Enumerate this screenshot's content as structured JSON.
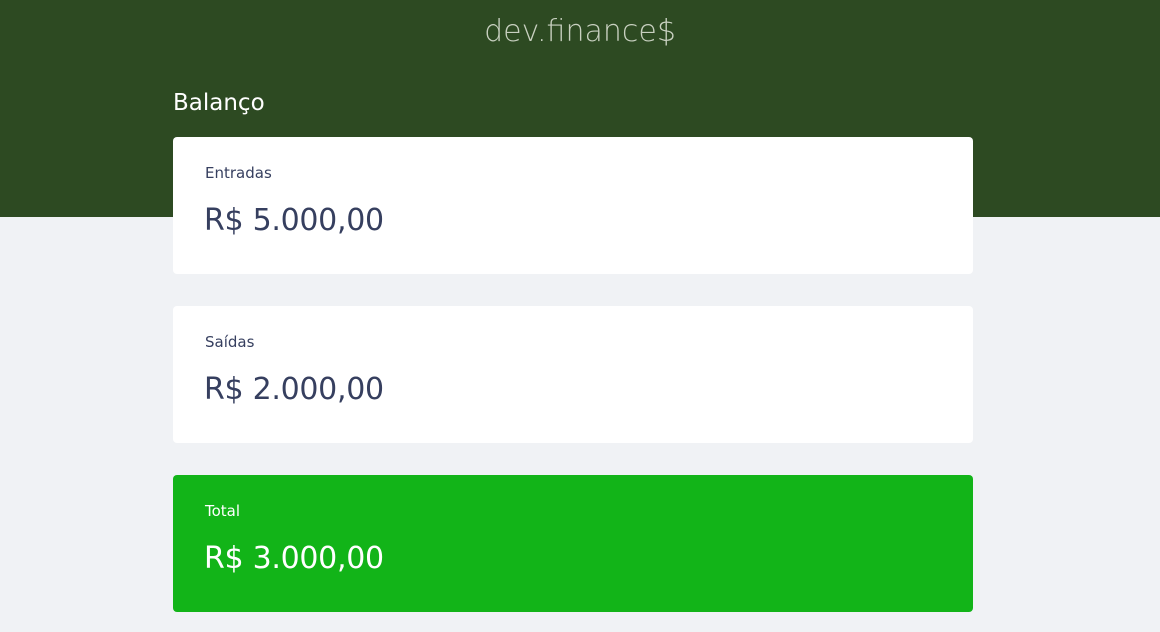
{
  "header": {
    "logo": "dev.finance$"
  },
  "balance": {
    "title": "Balanço",
    "cards": [
      {
        "label": "Entradas",
        "value": "R$ 5.000,00"
      },
      {
        "label": "Saídas",
        "value": "R$ 2.000,00"
      },
      {
        "label": "Total",
        "value": "R$ 3.000,00"
      }
    ]
  },
  "colors": {
    "header_bg": "#2d4a22",
    "page_bg": "#f0f2f5",
    "card_bg": "#ffffff",
    "total_bg": "#12b418",
    "text_dark": "#363f5f"
  }
}
